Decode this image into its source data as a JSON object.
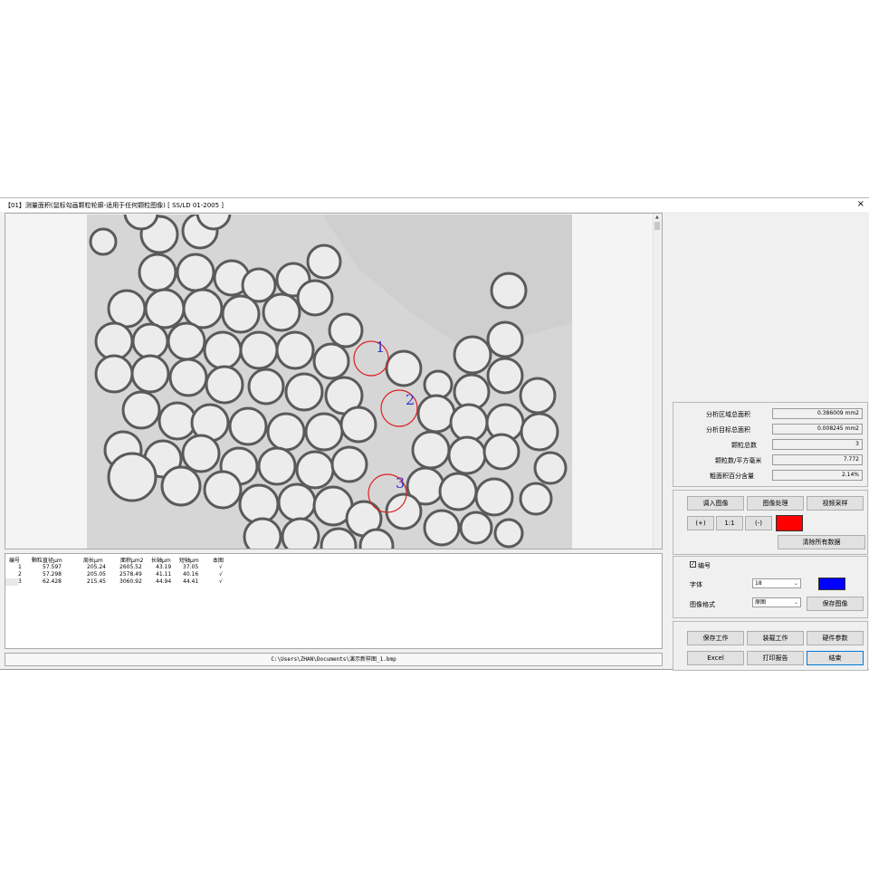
{
  "window": {
    "title": "【01】测量面积(鼠标勾画颗粒轮廓-适用于任何颗粒图像) [ SS/LD 01-2005 ]",
    "close_label": "×"
  },
  "image": {
    "labels": [
      "1",
      "2",
      "3"
    ],
    "colors": {
      "background": "#d9d9d9",
      "particle": "#e8e8e8",
      "outline": "#dd2222",
      "label": "#3333cc"
    }
  },
  "table": {
    "headers": [
      "编号",
      "颗粒直径μm",
      "周长μm",
      "面积μm2",
      "长轴μm",
      "短轴μm",
      "本图"
    ],
    "rows": [
      [
        "1",
        "57.597",
        "205.24",
        "2605.52",
        "43.19",
        "37.05",
        "√"
      ],
      [
        "2",
        "57.298",
        "205.05",
        "2578.49",
        "41.11",
        "40.16",
        "√"
      ],
      [
        "3",
        "62.428",
        "215.45",
        "3060.92",
        "44.94",
        "44.41",
        "√"
      ]
    ]
  },
  "path": "C:\\Users\\ZHAN\\Documents\\演示新样图_1.bmp",
  "stats": [
    {
      "label": "分析区域总面积",
      "value": "0.386009 mm2"
    },
    {
      "label": "分析目标总面积",
      "value": "0.008245 mm2"
    },
    {
      "label": "颗粒总数",
      "value": "3"
    },
    {
      "label": "颗粒数/平方毫米",
      "value": "7.772"
    },
    {
      "label": "粗面积百分含量",
      "value": "2.14%"
    }
  ],
  "image_buttons": {
    "load": "调入图像",
    "process": "图像处理",
    "video": "视频采样",
    "zoom_in": "(+)",
    "zoom_reset": "1:1",
    "zoom_out": "(-)",
    "clear": "清除所有数据",
    "color": "#ff0000"
  },
  "options": {
    "numbering_label": "编号",
    "numbering_checked": "✓",
    "font_label": "字体",
    "font_value": "18",
    "format_label": "图像格式",
    "format_value": "原图",
    "save_image": "保存图像",
    "label_color": "#0000ff"
  },
  "actions": {
    "save_work": "保存工作",
    "load_work": "装载工作",
    "hardware": "硬件参数",
    "excel": "Excel",
    "print": "打印报告",
    "exit": "结束"
  }
}
